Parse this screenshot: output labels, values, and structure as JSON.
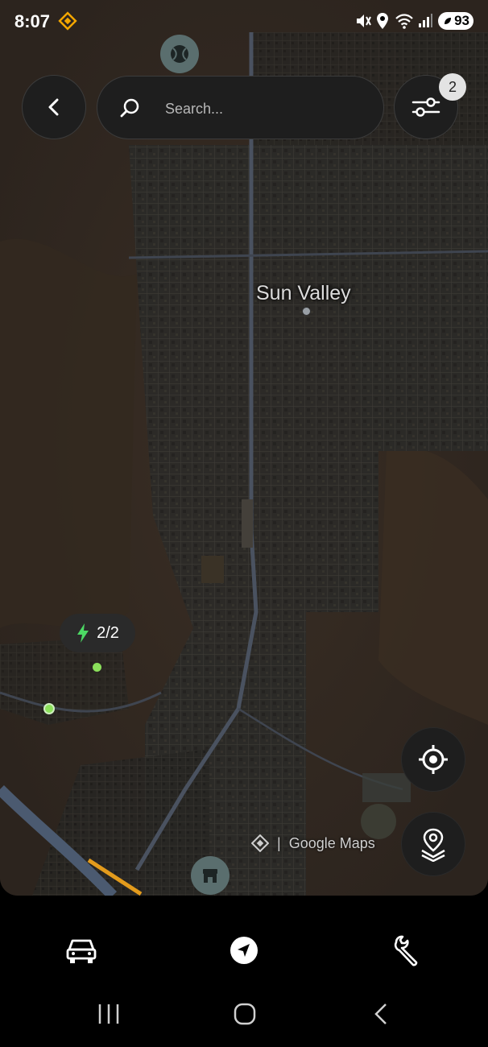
{
  "status_bar": {
    "time": "8:07",
    "battery": "93",
    "notification_icon": "diamond-app-icon",
    "icons": [
      "mute-vibrate-icon",
      "location-icon",
      "wifi-icon",
      "signal-icon",
      "battery-icon"
    ]
  },
  "header": {
    "back_icon": "chevron-left-icon",
    "search": {
      "placeholder": "Search...",
      "value": ""
    },
    "filter": {
      "icon": "sliders-icon",
      "badge_count": "2"
    }
  },
  "map": {
    "place_label": "Sun Valley",
    "charging_marker": {
      "label": "2/2",
      "icon": "lightning-icon",
      "color": "#4cd964"
    },
    "poi_markers": [
      "tennis-ball-icon",
      "store-icon"
    ],
    "attribution": {
      "separator": "|",
      "text": "Google Maps"
    },
    "controls": [
      "locate-me-icon",
      "map-layers-icon"
    ]
  },
  "bottom_nav": {
    "items": [
      "car-icon",
      "navigation-arrow-icon",
      "wrench-icon"
    ]
  },
  "system_nav": [
    "recents-icon",
    "home-icon",
    "back-icon"
  ],
  "colors": {
    "panel": "#1e1e1e",
    "accent_green": "#4cd964",
    "map_dark": "#2f2923"
  }
}
